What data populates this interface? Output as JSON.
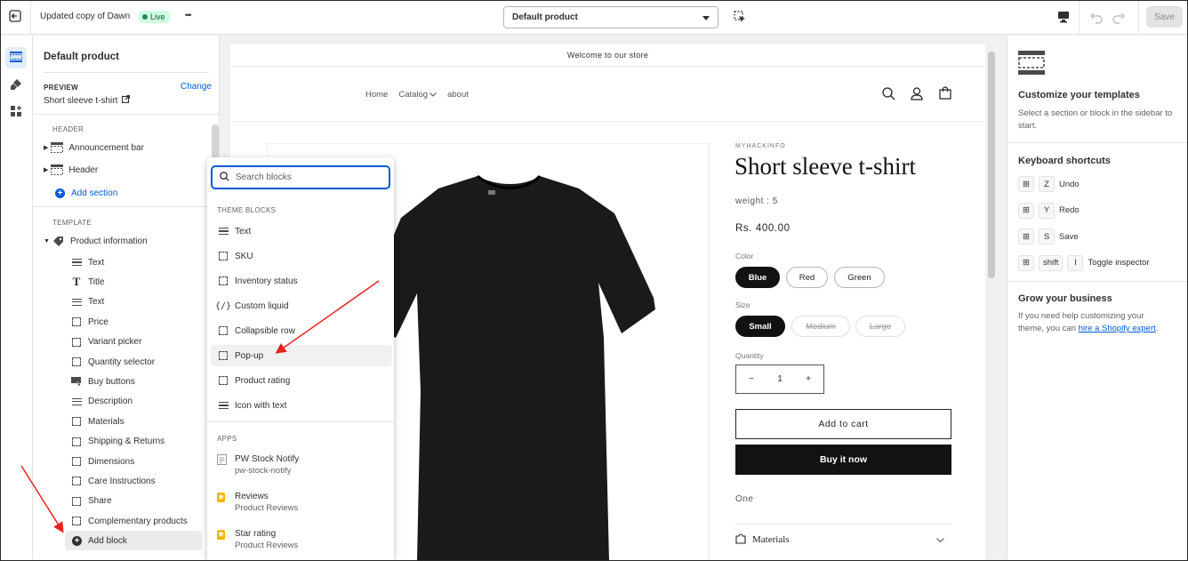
{
  "topbar": {
    "theme_name": "Updated copy of Dawn",
    "live_badge": "Live",
    "more": "•••",
    "template_select": "Default product",
    "save_label": "Save"
  },
  "sidebar": {
    "title": "Default product",
    "preview_label": "PREVIEW",
    "preview_value": "Short sleeve t-shirt",
    "change_label": "Change",
    "header_section": "HEADER",
    "header_items": [
      {
        "label": "Announcement bar"
      },
      {
        "label": "Header"
      }
    ],
    "add_section": "Add section",
    "template_section": "TEMPLATE",
    "product_info": "Product information",
    "blocks": [
      {
        "label": "Text",
        "icon": "lines-icon"
      },
      {
        "label": "Title",
        "icon": "title-icon"
      },
      {
        "label": "Text",
        "icon": "lines-icon"
      },
      {
        "label": "Price",
        "icon": "block-icon"
      },
      {
        "label": "Variant picker",
        "icon": "block-icon"
      },
      {
        "label": "Quantity selector",
        "icon": "block-icon"
      },
      {
        "label": "Buy buttons",
        "icon": "buy-icon"
      },
      {
        "label": "Description",
        "icon": "lines-icon"
      },
      {
        "label": "Materials",
        "icon": "block-icon"
      },
      {
        "label": "Shipping & Returns",
        "icon": "block-icon"
      },
      {
        "label": "Dimensions",
        "icon": "block-icon"
      },
      {
        "label": "Care Instructions",
        "icon": "block-icon"
      },
      {
        "label": "Share",
        "icon": "block-icon"
      },
      {
        "label": "Complementary products",
        "icon": "block-icon"
      }
    ],
    "add_block": "Add block"
  },
  "popup": {
    "search_placeholder": "Search blocks",
    "theme_blocks_label": "THEME BLOCKS",
    "theme_blocks": [
      {
        "label": "Text",
        "icon": "lines-icon"
      },
      {
        "label": "SKU",
        "icon": "block-icon"
      },
      {
        "label": "Inventory status",
        "icon": "block-icon"
      },
      {
        "label": "Custom liquid",
        "icon": "liquid-icon"
      },
      {
        "label": "Collapsible row",
        "icon": "block-icon"
      },
      {
        "label": "Pop-up",
        "icon": "block-icon"
      },
      {
        "label": "Product rating",
        "icon": "block-icon"
      },
      {
        "label": "Icon with text",
        "icon": "lines-icon"
      }
    ],
    "apps_label": "APPS",
    "apps": [
      {
        "name": "PW Stock Notify",
        "sub": "pw-stock-notify",
        "icon": "app-icon"
      },
      {
        "name": "Reviews",
        "sub": "Product Reviews",
        "icon": "star-icon"
      },
      {
        "name": "Star rating",
        "sub": "Product Reviews",
        "icon": "star-icon"
      }
    ]
  },
  "preview": {
    "announcement": "Welcome to our store",
    "nav": [
      "Home",
      "Catalog",
      "about"
    ],
    "vendor": "MYHACKINFO",
    "product_title": "Short sleeve t-shirt",
    "weight": "weight : 5",
    "price": "Rs. 400.00",
    "color_label": "Color",
    "colors": [
      "Blue",
      "Red",
      "Green"
    ],
    "size_label": "Size",
    "sizes": [
      "Small",
      "Medium",
      "Large"
    ],
    "quantity_label": "Quantity",
    "quantity_value": "1",
    "add_to_cart": "Add to cart",
    "buy_now": "Buy it now",
    "description": "One",
    "materials": "Materials"
  },
  "rpanel": {
    "title": "Customize your templates",
    "desc": "Select a section or block in the sidebar to start.",
    "shortcuts_title": "Keyboard shortcuts",
    "shortcuts": [
      {
        "key": "Z",
        "label": "Undo"
      },
      {
        "key": "Y",
        "label": "Redo"
      },
      {
        "key": "S",
        "label": "Save"
      },
      {
        "key": "shift",
        "key2": "I",
        "label": "Toggle inspector"
      }
    ],
    "grow_title": "Grow your business",
    "grow_desc": "If you need help customizing your theme, you can",
    "grow_link": "hire a Shopify expert",
    "grow_end": "."
  },
  "colors": {
    "accent": "#005bd3",
    "live_bg": "#cdfee1",
    "annotation_arrow": "#e8231d",
    "button_dark": "#121212"
  }
}
